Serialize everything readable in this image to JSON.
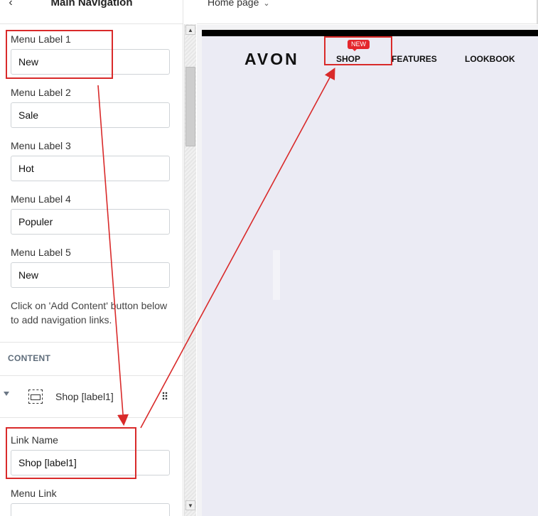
{
  "panel": {
    "title": "Main Navigation",
    "fields": [
      {
        "label": "Menu Label 1",
        "value": "New"
      },
      {
        "label": "Menu Label 2",
        "value": "Sale"
      },
      {
        "label": "Menu Label 3",
        "value": "Hot"
      },
      {
        "label": "Menu Label 4",
        "value": "Populer"
      },
      {
        "label": "Menu Label 5",
        "value": "New"
      }
    ],
    "hint": "Click on 'Add Content' button below to add navigation links.",
    "section_title": "CONTENT",
    "content_item": "Shop [label1]",
    "link_name_label": "Link Name",
    "link_name_value": "Shop [label1]",
    "menu_link_label": "Menu Link"
  },
  "topbar": {
    "page_select": "Home page"
  },
  "preview": {
    "logo": "AVON",
    "nav": [
      "SHOP",
      "FEATURES",
      "LOOKBOOK"
    ],
    "badge": "NEW"
  },
  "colors": {
    "annotation": "#d92a2a",
    "badge": "#e4262c",
    "canvas_bg": "#ebebf4"
  }
}
